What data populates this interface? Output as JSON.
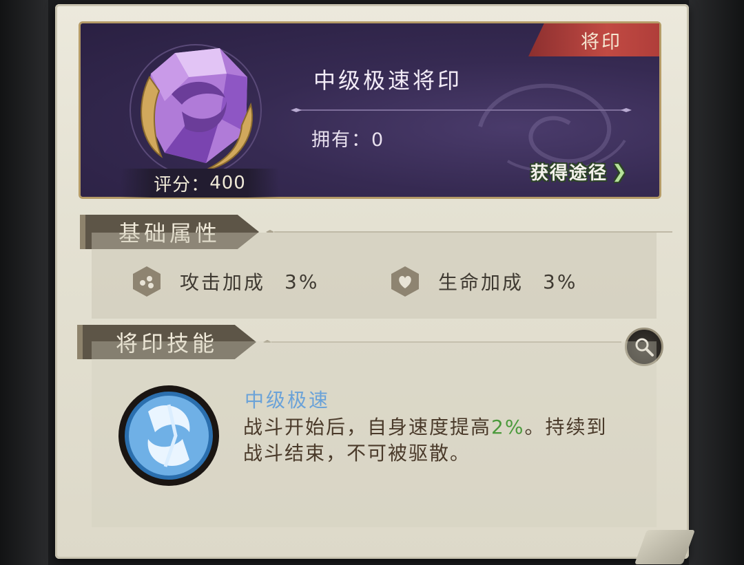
{
  "item": {
    "type_tag": "将印",
    "name": "中级极速将印",
    "owned_label": "拥有：",
    "owned_count": "0",
    "obtain_label": "获得途径",
    "score_label": "评分：",
    "score_value": "400",
    "gem_icon": "purple-crystal-gem-icon"
  },
  "basic": {
    "title": "基础属性",
    "attrs": [
      {
        "label": "攻击加成",
        "value": "3%",
        "icon": "attack-hex-icon"
      },
      {
        "label": "生命加成",
        "value": "3%",
        "icon": "health-hex-icon"
      }
    ]
  },
  "skill": {
    "title": "将印技能",
    "name": "中级极速",
    "desc_part1": "战斗开始后，自身速度提高",
    "desc_highlight": "2%",
    "desc_part2": "。持续到战斗结束，不可被驱散。",
    "icon": "speed-wind-skill-icon"
  },
  "colors": {
    "card_purple": "#362a52",
    "tag_red": "#c14a43",
    "skill_name_blue": "#6aa2d8",
    "highlight_green": "#4b9a3c"
  }
}
